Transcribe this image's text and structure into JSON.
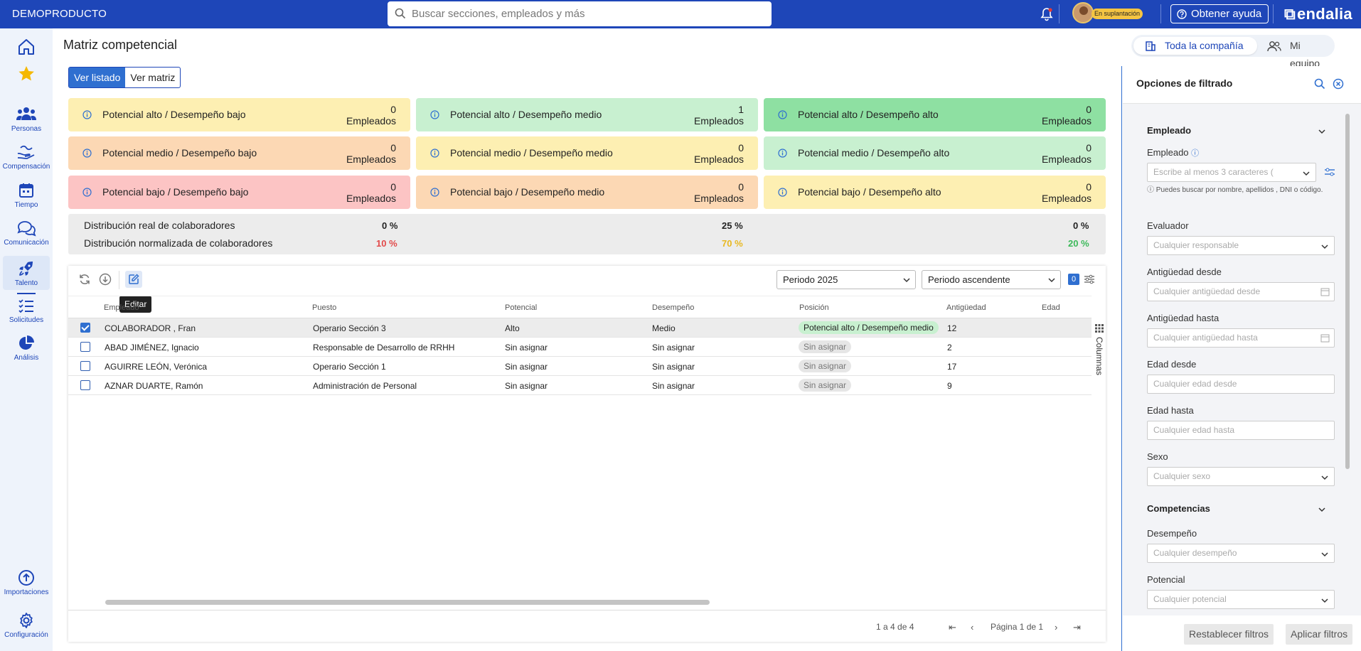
{
  "topbar": {
    "brand": "DEMOPRODUCTO",
    "search_placeholder": "Buscar secciones, empleados y más",
    "impersonation_badge": "En suplantación",
    "help_label": "Obtener ayuda",
    "logo_text": "endalia"
  },
  "sidebar": {
    "items": [
      {
        "label": "",
        "icon": "home-icon"
      },
      {
        "label": "",
        "icon": "star-icon"
      },
      {
        "label": "Personas",
        "icon": "people-icon"
      },
      {
        "label": "Compensación",
        "icon": "compensation-icon"
      },
      {
        "label": "Tiempo",
        "icon": "calendar-icon"
      },
      {
        "label": "Comunicación",
        "icon": "chat-icon"
      },
      {
        "label": "Talento",
        "icon": "rocket-icon"
      },
      {
        "label": "Solicitudes",
        "icon": "checklist-icon"
      },
      {
        "label": "Análisis",
        "icon": "pie-chart-icon"
      },
      {
        "label": "Importaciones",
        "icon": "upload-icon"
      },
      {
        "label": "Configuración",
        "icon": "gear-icon"
      }
    ]
  },
  "page": {
    "title": "Matriz competencial",
    "scope_company": "Toda la compañía",
    "scope_team": "Mi equipo",
    "view_list": "Ver listado",
    "view_matrix": "Ver matriz"
  },
  "cards": [
    {
      "label": "Potencial alto / Desempeño bajo",
      "count": "0",
      "unit": "Empleados"
    },
    {
      "label": "Potencial alto / Desempeño medio",
      "count": "1",
      "unit": "Empleados"
    },
    {
      "label": "Potencial alto / Desempeño alto",
      "count": "0",
      "unit": "Empleados"
    },
    {
      "label": "Potencial medio / Desempeño bajo",
      "count": "0",
      "unit": "Empleados"
    },
    {
      "label": "Potencial medio / Desempeño medio",
      "count": "0",
      "unit": "Empleados"
    },
    {
      "label": "Potencial medio / Desempeño alto",
      "count": "0",
      "unit": "Empleados"
    },
    {
      "label": "Potencial bajo / Desempeño bajo",
      "count": "0",
      "unit": "Empleados"
    },
    {
      "label": "Potencial bajo / Desempeño medio",
      "count": "0",
      "unit": "Empleados"
    },
    {
      "label": "Potencial bajo / Desempeño alto",
      "count": "0",
      "unit": "Empleados"
    }
  ],
  "distribution": {
    "real_label": "Distribución real de colaboradores",
    "normalized_label": "Distribución normalizada de colaboradores",
    "real_values": [
      "0 %",
      "25 %",
      "0 %"
    ],
    "normalized_values": [
      "10 %",
      "70 %",
      "20 %"
    ],
    "normalized_colors": [
      "#e24a4a",
      "#e8b820",
      "#3cb95a"
    ]
  },
  "toolbar": {
    "edit_tooltip": "Editar",
    "period_select": "Periodo 2025",
    "order_select": "Periodo ascendente",
    "filter_count": "0",
    "columns_label": "Columnas"
  },
  "table": {
    "headers": [
      "Empleado",
      "Puesto",
      "Potencial",
      "Desempeño",
      "Posición",
      "Antigüedad",
      "Edad"
    ],
    "rows": [
      {
        "checked": true,
        "empleado": "COLABORADOR , Fran",
        "puesto": "Operario Sección 3",
        "potencial": "Alto",
        "desempeno": "Medio",
        "posicion": "Potencial alto / Desempeño medio",
        "antiguedad": "12",
        "edad": ""
      },
      {
        "checked": false,
        "empleado": "ABAD JIMÉNEZ, Ignacio",
        "puesto": "Responsable de Desarrollo de RRHH",
        "potencial": "Sin asignar",
        "desempeno": "Sin asignar",
        "posicion": "Sin asignar",
        "antiguedad": "2",
        "edad": ""
      },
      {
        "checked": false,
        "empleado": "AGUIRRE LEÓN, Verónica",
        "puesto": "Operario Sección 1",
        "potencial": "Sin asignar",
        "desempeno": "Sin asignar",
        "posicion": "Sin asignar",
        "antiguedad": "17",
        "edad": ""
      },
      {
        "checked": false,
        "empleado": "AZNAR DUARTE, Ramón",
        "puesto": "Administración de Personal",
        "potencial": "Sin asignar",
        "desempeno": "Sin asignar",
        "posicion": "Sin asignar",
        "antiguedad": "9",
        "edad": ""
      }
    ],
    "pager_range": "1 a 4 de 4",
    "pager_page": "Página 1 de 1"
  },
  "filters": {
    "title": "Opciones de filtrado",
    "section_employee": "Empleado",
    "employee_label": "Empleado",
    "employee_placeholder": "Escribe al menos 3 caracteres (",
    "employee_hint": "ⓘ Puedes buscar por nombre, apellidos , DNI o código.",
    "evaluator_label": "Evaluador",
    "evaluator_placeholder": "Cualquier responsable",
    "seniority_from_label": "Antigüedad desde",
    "seniority_from_placeholder": "Cualquier antigüedad desde",
    "seniority_to_label": "Antigüedad hasta",
    "seniority_to_placeholder": "Cualquier antigüedad hasta",
    "age_from_label": "Edad desde",
    "age_from_placeholder": "Cualquier edad desde",
    "age_to_label": "Edad hasta",
    "age_to_placeholder": "Cualquier edad hasta",
    "sex_label": "Sexo",
    "sex_placeholder": "Cualquier sexo",
    "section_competencies": "Competencias",
    "performance_label": "Desempeño",
    "performance_placeholder": "Cualquier desempeño",
    "potential_label": "Potencial",
    "potential_placeholder": "Cualquier potencial",
    "reset_button": "Restablecer filtros",
    "apply_button": "Aplicar filtros"
  }
}
